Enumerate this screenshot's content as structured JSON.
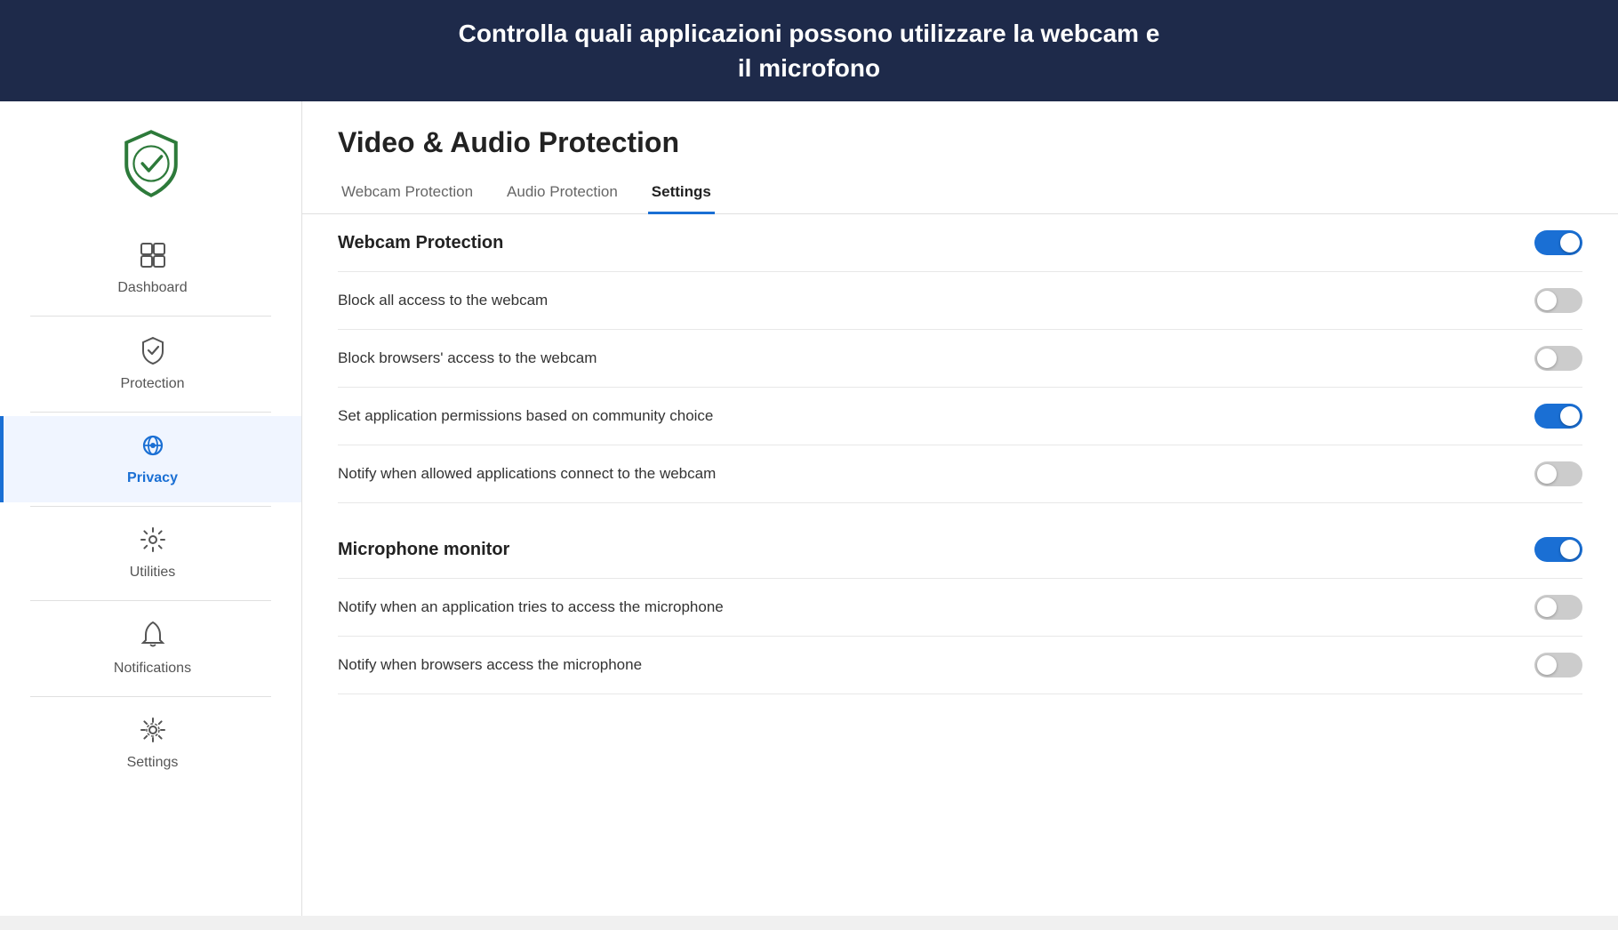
{
  "banner": {
    "text_line1": "Controlla quali applicazioni possono utilizzare la webcam e",
    "text_line2": "il microfono"
  },
  "sidebar": {
    "logo_alt": "Avast Shield Logo",
    "items": [
      {
        "id": "dashboard",
        "label": "Dashboard",
        "active": false
      },
      {
        "id": "protection",
        "label": "Protection",
        "active": false
      },
      {
        "id": "privacy",
        "label": "Privacy",
        "active": true
      },
      {
        "id": "utilities",
        "label": "Utilities",
        "active": false
      },
      {
        "id": "notifications",
        "label": "Notifications",
        "active": false
      },
      {
        "id": "settings",
        "label": "Settings",
        "active": false
      }
    ]
  },
  "main": {
    "title": "Video & Audio Protection",
    "tabs": [
      {
        "id": "webcam-protection",
        "label": "Webcam Protection",
        "active": false
      },
      {
        "id": "audio-protection",
        "label": "Audio Protection",
        "active": false
      },
      {
        "id": "settings",
        "label": "Settings",
        "active": true
      }
    ],
    "sections": [
      {
        "id": "webcam-section",
        "title": "Webcam Protection",
        "title_toggle": true,
        "title_toggle_checked": true,
        "rows": [
          {
            "id": "block-all-webcam",
            "label": "Block all access to the webcam",
            "checked": false
          },
          {
            "id": "block-browsers-webcam",
            "label": "Block browsers' access to the webcam",
            "checked": false
          },
          {
            "id": "set-app-permissions",
            "label": "Set application permissions based on community choice",
            "checked": true
          },
          {
            "id": "notify-webcam",
            "label": "Notify when allowed applications connect to the webcam",
            "checked": false
          }
        ]
      },
      {
        "id": "microphone-section",
        "title": "Microphone monitor",
        "title_toggle": true,
        "title_toggle_checked": true,
        "rows": [
          {
            "id": "notify-mic-access",
            "label": "Notify when an application tries to access the microphone",
            "checked": false
          },
          {
            "id": "notify-browser-mic",
            "label": "Notify when browsers access the microphone",
            "checked": false
          }
        ]
      }
    ]
  },
  "colors": {
    "active_blue": "#1a6fd4",
    "toggle_on": "#1a6fd4",
    "toggle_off": "#ccc",
    "sidebar_active_border": "#1a6fd4",
    "banner_bg": "#1e2a4a"
  }
}
